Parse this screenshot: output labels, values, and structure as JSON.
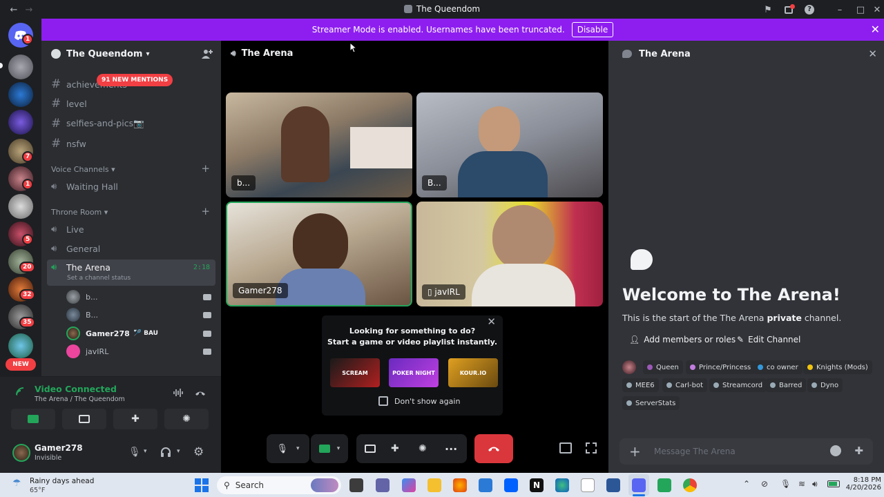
{
  "window": {
    "title": "The Queendom"
  },
  "banner": {
    "text": "Streamer Mode is enabled. Usernames have been truncated.",
    "action": "Disable"
  },
  "rail": {
    "badges": [
      "1",
      "7",
      "1",
      "5",
      "20",
      "32",
      "35"
    ],
    "new_label": "NEW"
  },
  "server": {
    "name": "The Queendom"
  },
  "mentions": "91 NEW MENTIONS",
  "text_channels": [
    "achievements",
    "level",
    "selfies-and-pics📷",
    "nsfw"
  ],
  "categories": {
    "voice": "Voice Channels",
    "throne": "Throne Room"
  },
  "voice_channels": {
    "waiting": "Waiting Hall",
    "live": "Live",
    "general": "General",
    "arena": "The Arena",
    "arena_time": "2:18",
    "arena_status": "Set a channel status"
  },
  "voice_users": [
    {
      "name": "b..."
    },
    {
      "name": "B..."
    },
    {
      "name": "Gamer278",
      "tag": "BAU"
    },
    {
      "name": "javIRL"
    }
  ],
  "voice_panel": {
    "status": "Video Connected",
    "location": "The Arena / The Queendom"
  },
  "user": {
    "name": "Gamer278",
    "status": "Invisible"
  },
  "call": {
    "title": "The Arena",
    "tiles": [
      "b...",
      "B...",
      "Gamer278",
      "javIRL"
    ],
    "suggest_line1": "Looking for something to do?",
    "suggest_line2": "Start a game or video playlist instantly.",
    "games": [
      "SCREAM",
      "POKER NIGHT",
      "KOUR.IO"
    ],
    "dont_show": "Don't show again"
  },
  "chat": {
    "title": "The Arena",
    "welcome": "Welcome to The Arena!",
    "intro_pre": "This is the start of the The Arena ",
    "intro_bold": "private",
    "intro_post": " channel.",
    "add_members": "Add members or roles",
    "edit_channel": "Edit Channel",
    "roles": [
      {
        "name": "Queen",
        "color": "#9b59b6"
      },
      {
        "name": "Prince/Princess",
        "color": "#c27cde"
      },
      {
        "name": "co owner",
        "color": "#3498db"
      },
      {
        "name": "Knights (Mods)",
        "color": "#f1c40f"
      },
      {
        "name": "MEE6",
        "color": "#99aab5"
      },
      {
        "name": "Carl-bot",
        "color": "#99aab5"
      },
      {
        "name": "Streamcord",
        "color": "#99aab5"
      },
      {
        "name": "Barred",
        "color": "#99aab5"
      },
      {
        "name": "Dyno",
        "color": "#99aab5"
      },
      {
        "name": "ServerStats",
        "color": "#99aab5"
      }
    ],
    "placeholder": "Message The Arena"
  },
  "taskbar": {
    "weather_title": "Rainy days ahead",
    "weather_temp": "65°F",
    "search": "Search",
    "time": "8:18 PM",
    "date": "4/20/2026"
  },
  "colors": {
    "accent": "#8e1ef0",
    "green": "#23a55a",
    "red": "#da373c"
  }
}
